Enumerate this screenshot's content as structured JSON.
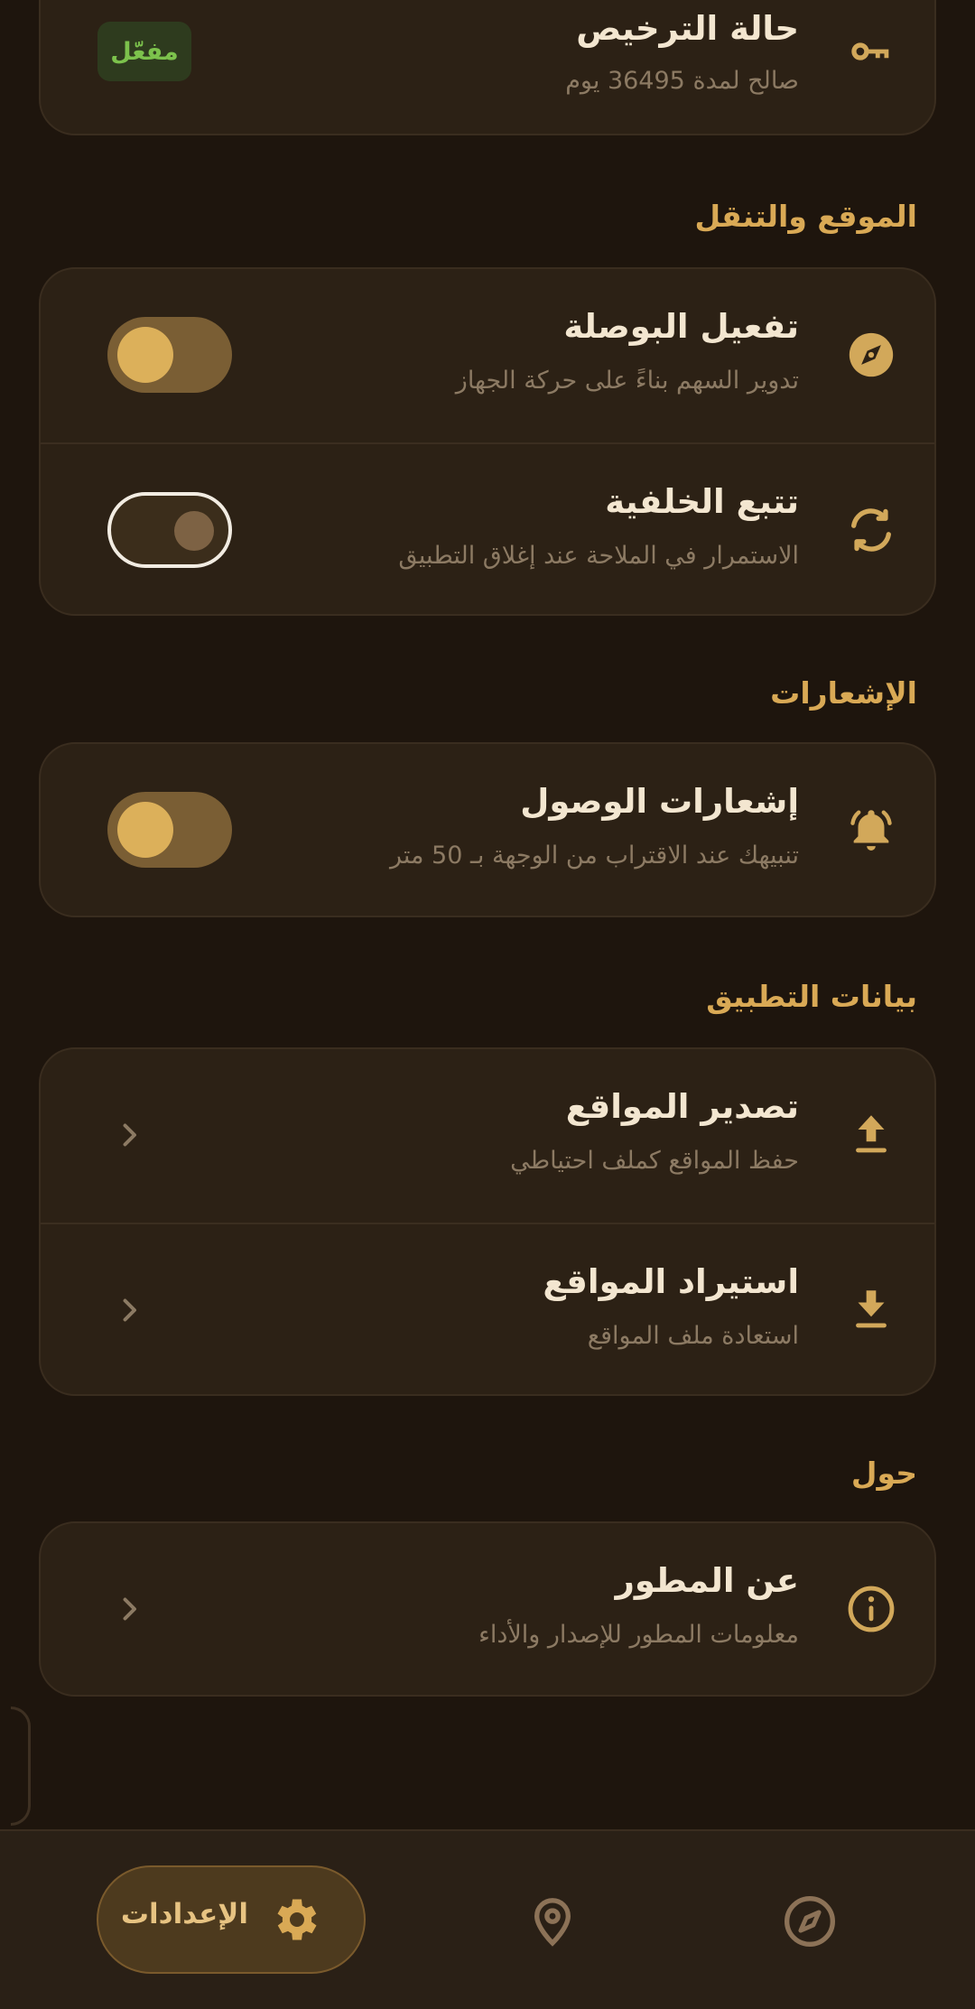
{
  "license": {
    "title": "حالة الترخيص",
    "subtitle": "صالح لمدة 36495 يوم",
    "badge": "مفعّل",
    "icon": "key-icon"
  },
  "sections": {
    "location": "الموقع والتنقل",
    "notifications": "الإشعارات",
    "app_data": "بيانات التطبيق",
    "about": "حول"
  },
  "location_items": [
    {
      "title": "تفعيل البوصلة",
      "subtitle": "تدوير السهم بناءً على حركة الجهاز",
      "icon": "compass-icon",
      "toggle": true
    },
    {
      "title": "تتبع الخلفية",
      "subtitle": "الاستمرار في الملاحة عند إغلاق التطبيق",
      "icon": "sync-icon",
      "toggle": false
    }
  ],
  "notification_items": [
    {
      "title": "إشعارات الوصول",
      "subtitle": "تنبيهك عند الاقتراب من الوجهة بـ 50 متر",
      "icon": "bell-icon",
      "toggle": true
    }
  ],
  "data_items": [
    {
      "title": "تصدير المواقع",
      "subtitle": "حفظ المواقع كملف احتياطي",
      "icon": "upload-icon"
    },
    {
      "title": "استيراد المواقع",
      "subtitle": "استعادة ملف المواقع",
      "icon": "download-icon"
    }
  ],
  "about_items": [
    {
      "title": "عن المطور",
      "subtitle": "معلومات المطور للإصدار والأداء",
      "icon": "info-icon"
    }
  ],
  "bottom_nav": {
    "settings_label": "الإعدادات",
    "active": "settings"
  },
  "colors": {
    "accent": "#d9a955",
    "background": "#1e150d",
    "card": "#2c2115",
    "badge_text": "#7cc24c"
  }
}
